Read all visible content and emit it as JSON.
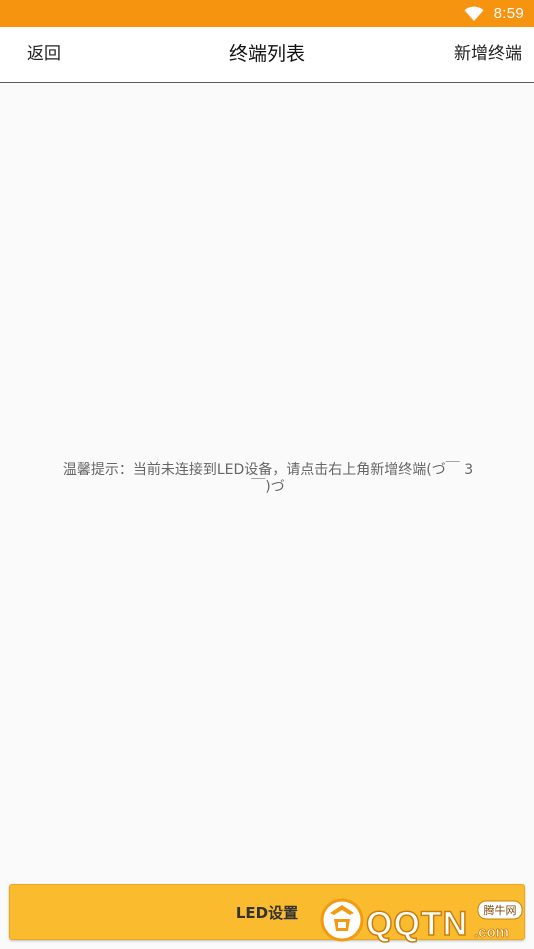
{
  "status_bar": {
    "time": "8:59",
    "icons": [
      "wifi-icon"
    ],
    "background_color": "#f6940f"
  },
  "header": {
    "back_label": "返回",
    "title": "终端列表",
    "add_label": "新增终端"
  },
  "content": {
    "empty_hint": "温馨提示：当前未连接到LED设备，请点击右上角新增终端(づ￣ 3￣)づ"
  },
  "footer": {
    "led_settings_label": "LED设置",
    "button_color": "#fbbb2f"
  },
  "watermark": {
    "brand": "QQTN",
    "domain_suffix": ".com",
    "badge": "腾牛网"
  }
}
